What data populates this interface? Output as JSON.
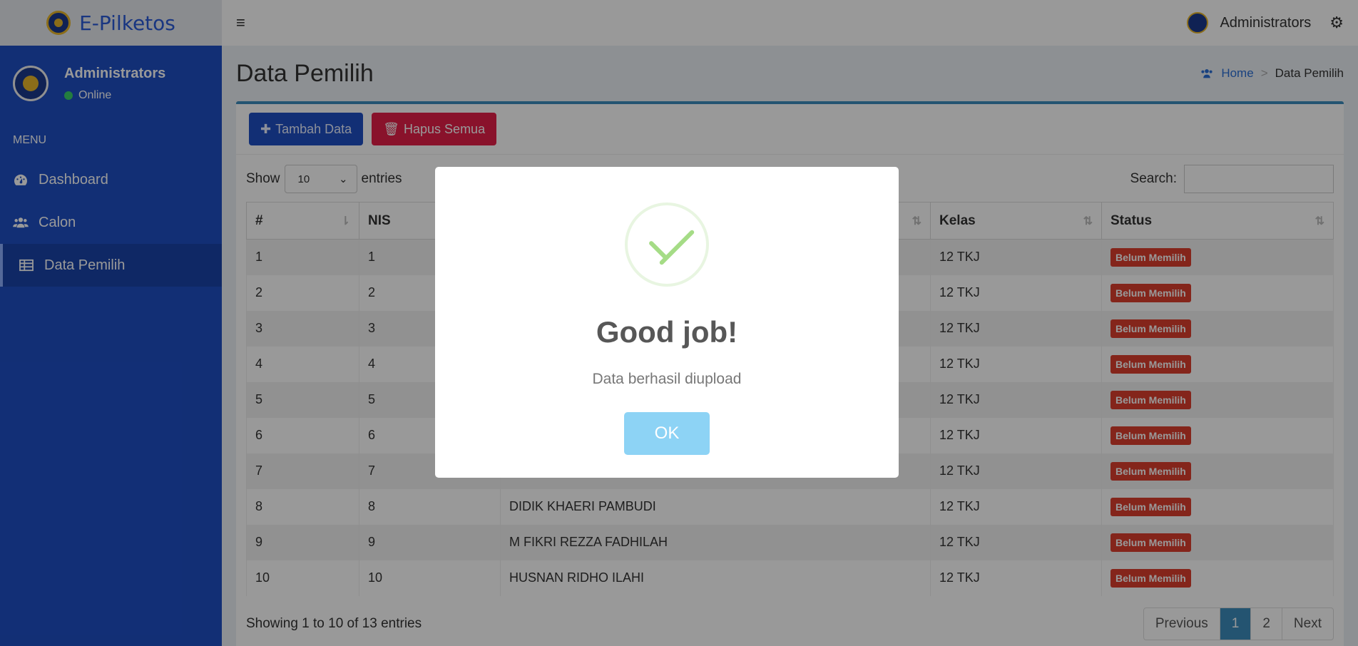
{
  "brand": {
    "name": "E-Pilketos"
  },
  "sidebar": {
    "user": {
      "name": "Administrators",
      "status": "Online"
    },
    "menu_header": "MENU",
    "items": [
      {
        "label": "Dashboard",
        "icon": "dashboard-icon"
      },
      {
        "label": "Calon",
        "icon": "users-icon"
      },
      {
        "label": "Data Pemilih",
        "icon": "table-icon"
      }
    ]
  },
  "topbar": {
    "menu_icon": "≡",
    "user_name": "Administrators",
    "settings_icon": "⚙"
  },
  "content": {
    "title": "Data Pemilih",
    "breadcrumb": {
      "home": "Home",
      "current": "Data Pemilih"
    },
    "buttons": {
      "add": "Tambah Data",
      "delete_all": "Hapus Semua"
    },
    "table_controls": {
      "show": "Show",
      "entries_value": "10",
      "entries": "entries",
      "search": "Search:"
    },
    "table": {
      "headers": [
        "#",
        "NIS",
        "",
        "Kelas",
        "Status"
      ],
      "rows": [
        {
          "no": "1",
          "nis": "1",
          "nama": "",
          "kelas": "12 TKJ",
          "status": "Belum Memilih"
        },
        {
          "no": "2",
          "nis": "2",
          "nama": "",
          "kelas": "12 TKJ",
          "status": "Belum Memilih"
        },
        {
          "no": "3",
          "nis": "3",
          "nama": "",
          "kelas": "12 TKJ",
          "status": "Belum Memilih"
        },
        {
          "no": "4",
          "nis": "4",
          "nama": "",
          "kelas": "12 TKJ",
          "status": "Belum Memilih"
        },
        {
          "no": "5",
          "nis": "5",
          "nama": "",
          "kelas": "12 TKJ",
          "status": "Belum Memilih"
        },
        {
          "no": "6",
          "nis": "6",
          "nama": "",
          "kelas": "12 TKJ",
          "status": "Belum Memilih"
        },
        {
          "no": "7",
          "nis": "7",
          "nama": "",
          "kelas": "12 TKJ",
          "status": "Belum Memilih"
        },
        {
          "no": "8",
          "nis": "8",
          "nama": "DIDIK KHAERI PAMBUDI",
          "kelas": "12 TKJ",
          "status": "Belum Memilih"
        },
        {
          "no": "9",
          "nis": "9",
          "nama": "M FIKRI REZZA FADHILAH",
          "kelas": "12 TKJ",
          "status": "Belum Memilih"
        },
        {
          "no": "10",
          "nis": "10",
          "nama": "HUSNAN RIDHO ILAHI",
          "kelas": "12 TKJ",
          "status": "Belum Memilih"
        }
      ]
    },
    "footer": {
      "info": "Showing 1 to 10 of 13 entries",
      "pagination": {
        "previous": "Previous",
        "page1": "1",
        "page2": "2",
        "next": "Next"
      }
    }
  },
  "modal": {
    "title": "Good job!",
    "text": "Data berhasil diupload",
    "ok": "OK",
    "icon": "success-check-icon"
  }
}
